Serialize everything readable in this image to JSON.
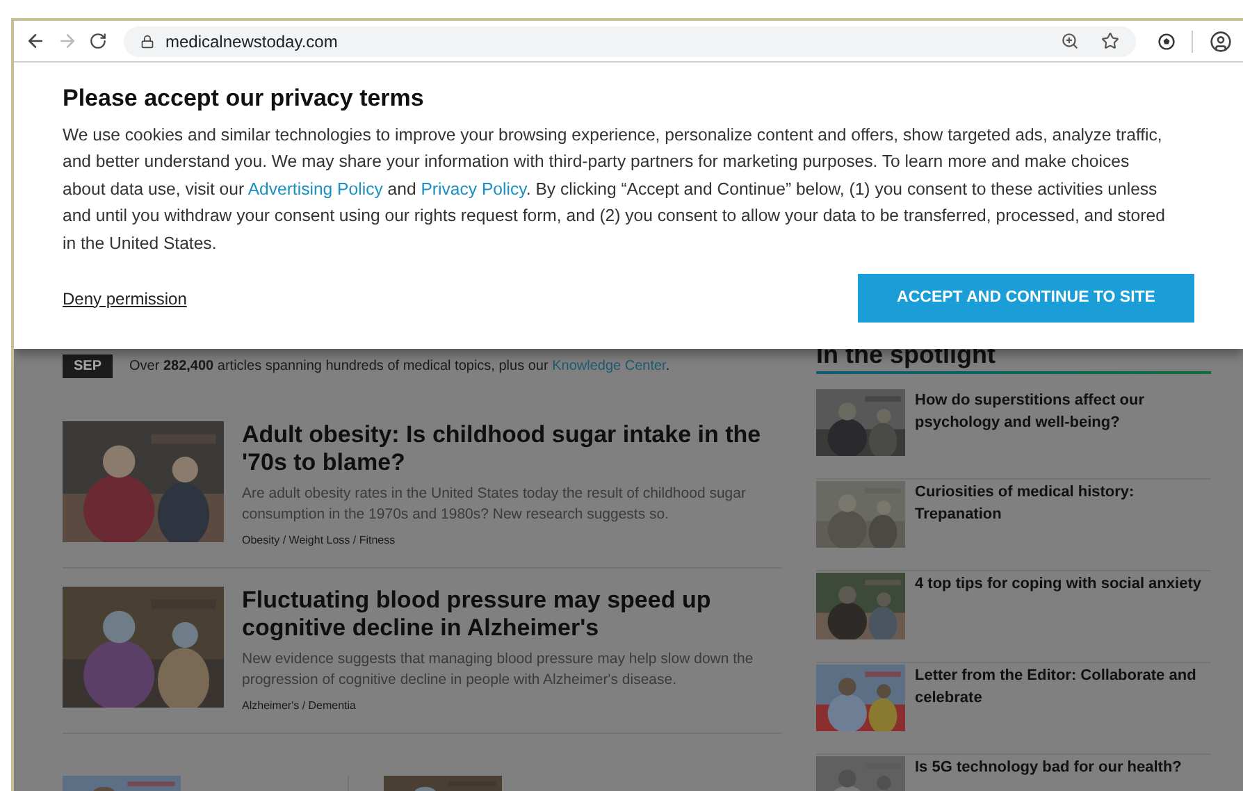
{
  "browser": {
    "url": "medicalnewstoday.com",
    "back_enabled": true,
    "forward_enabled": false
  },
  "modal": {
    "title": "Please accept our privacy terms",
    "paragraph": [
      {
        "kind": "text",
        "text": "We use cookies and similar technologies to improve your browsing experience, personalize content and offers, show targeted ads, analyze traffic, and better understand you. We may share your information with third-party partners for marketing purposes. To learn more and make choices about data use, visit our "
      },
      {
        "kind": "link",
        "text": "Advertising Policy"
      },
      {
        "kind": "text",
        "text": " and "
      },
      {
        "kind": "link",
        "text": "Privacy Policy"
      },
      {
        "kind": "text",
        "text": ". By clicking “Accept and Continue” below, (1) you consent to these activities unless and until you withdraw your consent using our rights request form, and (2) you consent to allow your data to be transferred, processed, and stored in the United States."
      }
    ],
    "deny_link": "Deny permission",
    "accept_button": "ACCEPT AND CONTINUE TO SITE"
  },
  "banner": {
    "badge": "SEP",
    "parts": [
      {
        "kind": "text",
        "text": "Over **282,400** articles spanning hundreds of medical topics, plus our "
      },
      {
        "kind": "link",
        "text": "Knowledge Center"
      },
      {
        "kind": "text",
        "text": "."
      }
    ]
  },
  "articles": [
    {
      "title": "Adult obesity: Is childhood sugar intake in the '70s to blame?",
      "summary": "Are adult obesity rates in the United States today the result of childhood sugar consumption in the 1970s and 1980s? New research suggests so.",
      "tags": "Obesity / Weight Loss / Fitness"
    },
    {
      "title": "Fluctuating blood pressure may speed up cognitive decline in Alzheimer's",
      "summary": "New evidence suggests that managing blood pressure may help slow down the progression of cognitive decline in people with Alzheimer's disease.",
      "tags": "Alzheimer's / Dementia"
    }
  ],
  "spotlight": {
    "heading": "In the spotlight",
    "items": [
      {
        "title": "How do superstitions affect our psychology and well-being?"
      },
      {
        "title": "Curiosities of medical history: Trepanation"
      },
      {
        "title": "4 top tips for coping with social anxiety"
      },
      {
        "title": "Letter from the Editor: Collaborate and celebrate"
      },
      {
        "title": "Is 5G technology bad for our health?"
      }
    ]
  }
}
